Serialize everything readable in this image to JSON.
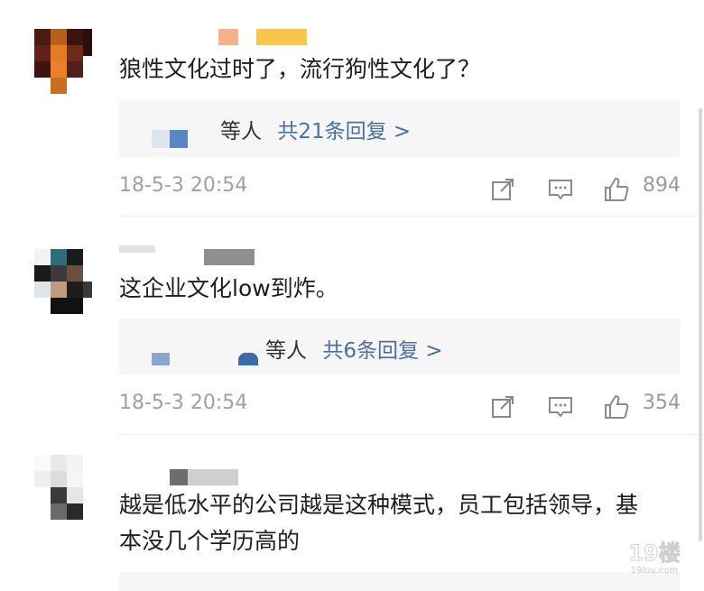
{
  "comments": [
    {
      "text": "狼性文化过时了，流行狗性文化了？",
      "reply_prefix": "等人",
      "reply_link": "共21条回复 >",
      "time": "18-5-3 20:54",
      "likes": "894"
    },
    {
      "text": "这企业文化low到炸。",
      "reply_prefix": "等人",
      "reply_link": "共6条回复 >",
      "time": "18-5-3 20:54",
      "likes": "354"
    },
    {
      "text": "越是低水平的公司越是这种模式，员工包括领导，基本没几个学历高的"
    }
  ],
  "icons": {
    "share": "share-icon",
    "reply": "comment-icon",
    "like": "thumbs-up-icon"
  },
  "watermark": {
    "logo": "19楼",
    "site": "19lou.com"
  },
  "colors": {
    "link": "#4a6fa5",
    "meta": "#a0a0a0",
    "reply_bg": "#f6f6f6"
  }
}
